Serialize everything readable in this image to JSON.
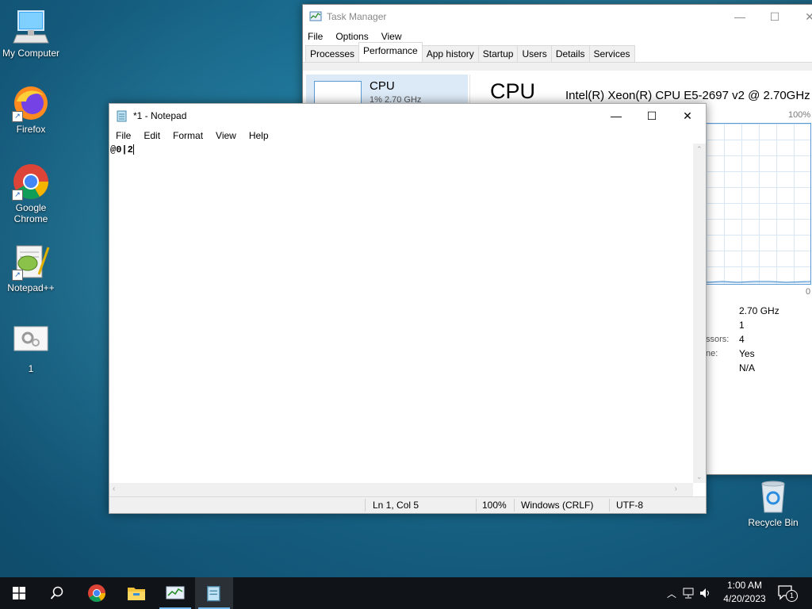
{
  "desktop": {
    "icons": [
      {
        "label": "My Computer"
      },
      {
        "label": "Firefox"
      },
      {
        "label": "Google Chrome"
      },
      {
        "label": "Notepad++"
      },
      {
        "label": "1"
      },
      {
        "label": "Recycle Bin"
      }
    ]
  },
  "task_manager": {
    "title": "Task Manager",
    "menu": [
      "File",
      "Options",
      "View"
    ],
    "tabs": [
      "Processes",
      "Performance",
      "App history",
      "Startup",
      "Users",
      "Details",
      "Services"
    ],
    "active_tab": "Performance",
    "cpu_item": {
      "label": "CPU",
      "detail": "1% 2.70 GHz"
    },
    "cpu_heading": "CPU",
    "cpu_model": "Intel(R) Xeon(R) CPU E5-2697 v2 @ 2.70GHz",
    "graph_max": "100%",
    "graph_min": "0",
    "stats_partial_labels": [
      "ssors:",
      "ne:"
    ],
    "stats_values": [
      "2.70 GHz",
      "1",
      "4",
      "Yes",
      "N/A"
    ]
  },
  "notepad": {
    "title": "*1 - Notepad",
    "menu": [
      "File",
      "Edit",
      "Format",
      "View",
      "Help"
    ],
    "content": "@0|2",
    "status": {
      "position": "Ln 1, Col 5",
      "zoom": "100%",
      "line_ending": "Windows (CRLF)",
      "encoding": "UTF-8"
    }
  },
  "taskbar": {
    "time": "1:00 AM",
    "date": "4/20/2023",
    "notification_count": "1"
  },
  "colors": {
    "accent": "#0078d7",
    "taskbar": "#101318"
  }
}
